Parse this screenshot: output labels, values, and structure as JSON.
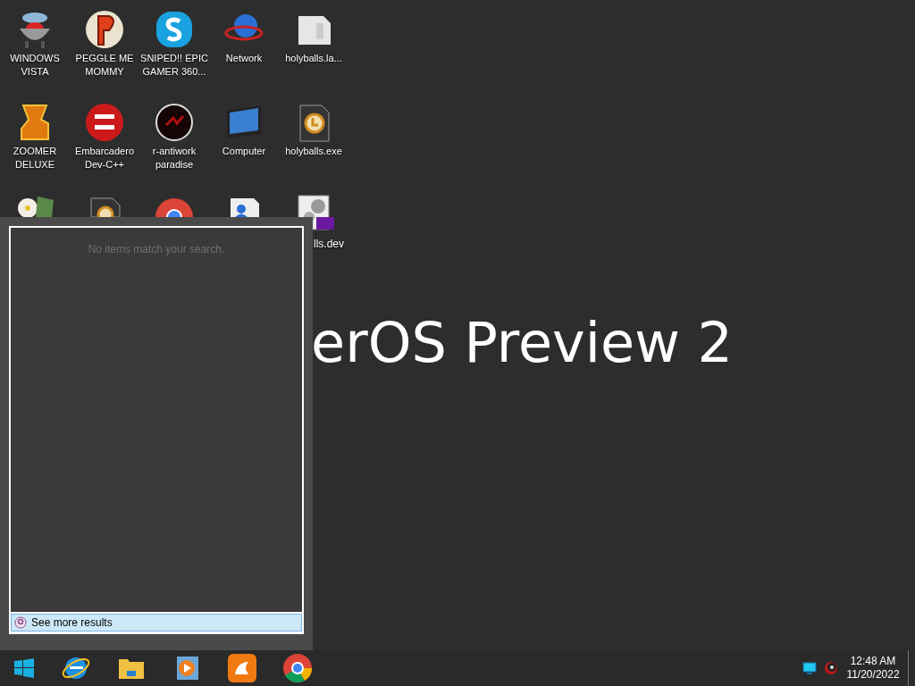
{
  "desktop": {
    "icons": [
      {
        "label": "WINDOWS VISTA"
      },
      {
        "label": "PEGGLE ME MOMMY"
      },
      {
        "label": "SNIPED!! EPIC GAMER 360..."
      },
      {
        "label": "Network"
      },
      {
        "label": "holyballs.la..."
      },
      {
        "label": "ZOOMER DELUXE"
      },
      {
        "label": "Embarcadero Dev-C++"
      },
      {
        "label": "r-antiwork paradise"
      },
      {
        "label": "Computer"
      },
      {
        "label": "holyballs.exe"
      }
    ],
    "partial_icon_label": "lls.dev",
    "wallpaper_text": "erOS Preview 2"
  },
  "start_menu": {
    "empty_message": "No items match your search.",
    "see_more": "See more results"
  },
  "taskbar": {
    "clock": {
      "time": "12:48 AM",
      "date": "11/20/2022"
    }
  }
}
